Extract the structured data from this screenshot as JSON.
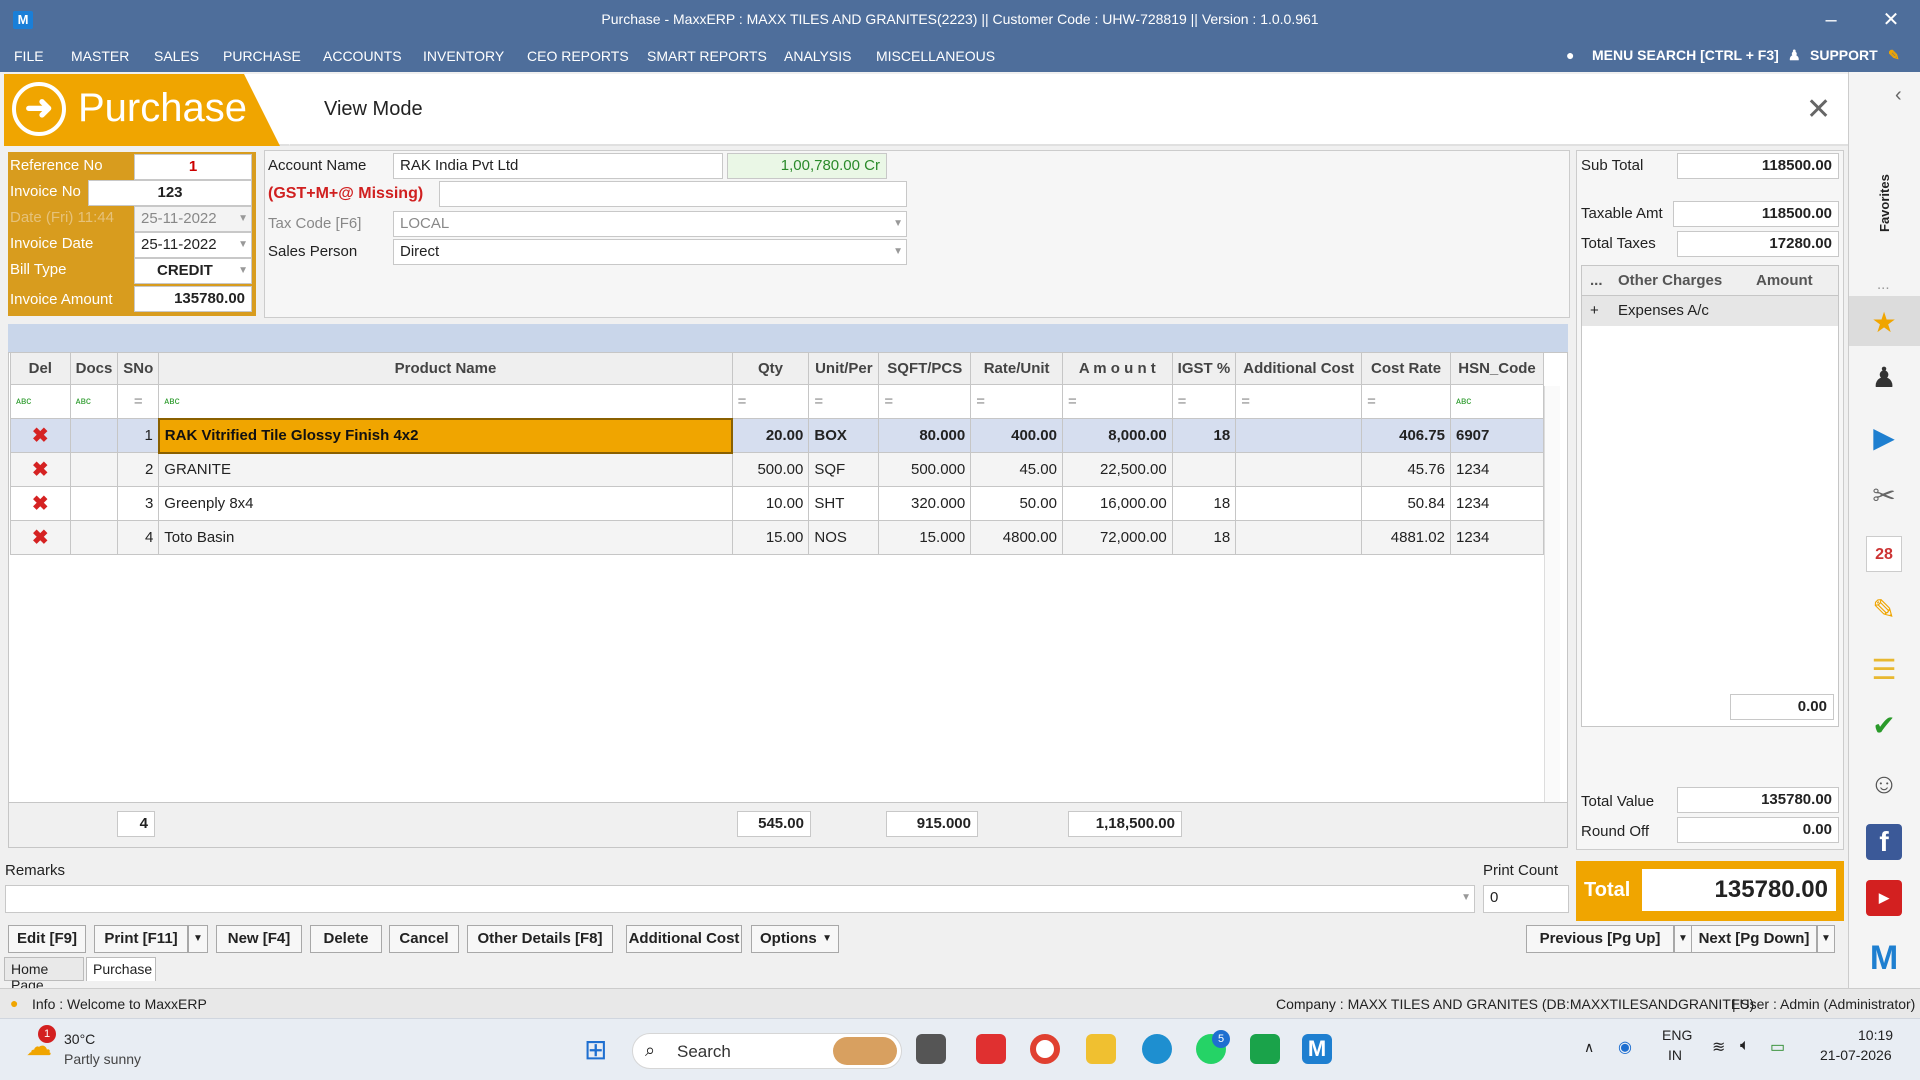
{
  "window": {
    "title": "Purchase - MaxxERP : MAXX TILES AND GRANITES(2223)  ||  Customer Code : UHW-728819  ||  Version : 1.0.0.961",
    "app_logo": "M",
    "minimize": "–",
    "close": "✕"
  },
  "menu": {
    "items": [
      "FILE",
      "MASTER",
      "SALES",
      "PURCHASE",
      "ACCOUNTS",
      "INVENTORY",
      "CEO REPORTS",
      "SMART REPORTS",
      "ANALYSIS",
      "MISCELLANEOUS"
    ],
    "search": "MENU SEARCH [CTRL + F3]",
    "support": "SUPPORT"
  },
  "banner": {
    "title": "Purchase",
    "mode": "View Mode",
    "close": "✕"
  },
  "header": {
    "reference_no_label": "Reference No",
    "reference_no": "1",
    "invoice_no_label": "Invoice No",
    "invoice_no": "123",
    "date_label": "Date (Fri) 11:44",
    "date": "25-11-2022",
    "invoice_date_label": "Invoice Date",
    "invoice_date": "25-11-2022",
    "bill_type_label": "Bill Type",
    "bill_type": "CREDIT",
    "invoice_amount_label": "Invoice Amount",
    "invoice_amount": "135780.00",
    "account_name_label": "Account Name",
    "account_name": "RAK India Pvt Ltd",
    "account_balance": "1,00,780.00 Cr",
    "gst_warning": "(GST+M+@ Missing)",
    "tax_code_label": "Tax Code [F6]",
    "tax_code": "LOCAL",
    "sales_person_label": "Sales Person",
    "sales_person": "Direct"
  },
  "grid": {
    "columns": [
      "Del",
      "Docs",
      "SNo",
      "Product Name",
      "Qty",
      "Unit/Per",
      "SQFT/PCS",
      "Rate/Unit",
      "A m o u n t",
      "IGST %",
      "Additional Cost",
      "Cost Rate",
      "HSN_Code"
    ],
    "rows": [
      {
        "del": "✖",
        "docs": "",
        "sno": "1",
        "product": "RAK Vitrified Tile Glossy Finish 4x2",
        "qty": "20.00",
        "unit": "BOX",
        "sqft": "80.000",
        "rate": "400.00",
        "amount": "8,000.00",
        "igst": "18",
        "addcost": "",
        "costrate": "406.75",
        "hsn": "6907"
      },
      {
        "del": "✖",
        "docs": "",
        "sno": "2",
        "product": "GRANITE",
        "qty": "500.00",
        "unit": "SQF",
        "sqft": "500.000",
        "rate": "45.00",
        "amount": "22,500.00",
        "igst": "",
        "addcost": "",
        "costrate": "45.76",
        "hsn": "1234"
      },
      {
        "del": "✖",
        "docs": "",
        "sno": "3",
        "product": "Greenply 8x4",
        "qty": "10.00",
        "unit": "SHT",
        "sqft": "320.000",
        "rate": "50.00",
        "amount": "16,000.00",
        "igst": "18",
        "addcost": "",
        "costrate": "50.84",
        "hsn": "1234"
      },
      {
        "del": "✖",
        "docs": "",
        "sno": "4",
        "product": "Toto Basin",
        "qty": "15.00",
        "unit": "NOS",
        "sqft": "15.000",
        "rate": "4800.00",
        "amount": "72,000.00",
        "igst": "18",
        "addcost": "",
        "costrate": "4881.02",
        "hsn": "1234"
      }
    ],
    "totals": {
      "count": "4",
      "qty": "545.00",
      "sqft": "915.000",
      "amount": "1,18,500.00"
    }
  },
  "summary": {
    "sub_total_label": "Sub Total",
    "sub_total": "118500.00",
    "taxable_label": "Taxable Amt",
    "taxable": "118500.00",
    "total_taxes_label": "Total Taxes",
    "total_taxes": "17280.00",
    "oc_dots": "...",
    "oc_header": "Other Charges",
    "oc_amount_header": "Amount",
    "oc_plus": "+",
    "oc_row": "Expenses A/c",
    "oc_total": "0.00",
    "total_value_label": "Total Value",
    "total_value": "135780.00",
    "round_off_label": "Round Off",
    "round_off": "0.00",
    "total_label": "Total",
    "total": "135780.00"
  },
  "remarks": {
    "label": "Remarks",
    "print_count_label": "Print Count",
    "print_count": "0"
  },
  "buttons": {
    "edit": "Edit [F9]",
    "print": "Print [F11]",
    "new": "New [F4]",
    "delete": "Delete",
    "cancel": "Cancel",
    "other_details": "Other Details [F8]",
    "additional_cost": "Additional Cost",
    "options": "Options",
    "previous": "Previous [Pg Up]",
    "next": "Next [Pg Down]"
  },
  "tabs": [
    "Home Page",
    "Purchase"
  ],
  "status": {
    "info": "Info : Welcome to MaxxERP",
    "company": "Company : MAXX TILES AND GRANITES (DB:MAXXTILESANDGRANITES)",
    "user": "| User : Admin (Administrator)"
  },
  "sidebar": {
    "favorites": "Favorites",
    "dots": "...",
    "collapse": "‹"
  },
  "taskbar": {
    "temp": "30°C",
    "weather": "Partly sunny",
    "weather_badge": "1",
    "search": "Search",
    "whatsapp_badge": "5",
    "lang1": "ENG",
    "lang2": "IN",
    "time": "10:19",
    "date": "21-07-2026"
  }
}
